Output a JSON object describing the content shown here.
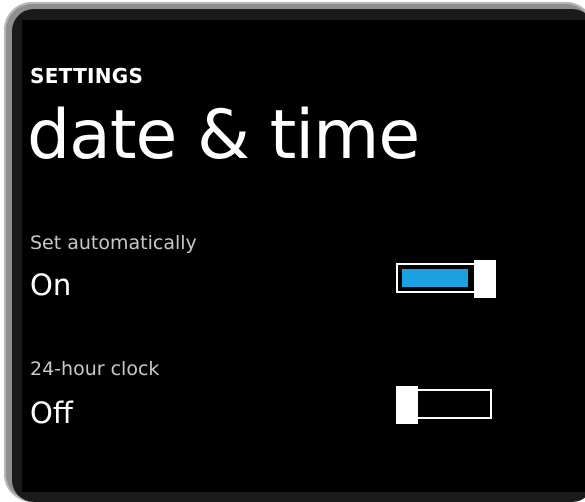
{
  "header": {
    "app_title": "SETTINGS",
    "page_title": "date & time"
  },
  "settings": [
    {
      "label": "Set automatically",
      "value": "On",
      "enabled": true
    },
    {
      "label": "24-hour clock",
      "value": "Off",
      "enabled": false
    }
  ],
  "colors": {
    "background": "#000000",
    "text": "#ffffff",
    "label_text": "#c8c8c8",
    "accent": "#1ba1e2",
    "device_frame": "#8f8f8f"
  }
}
